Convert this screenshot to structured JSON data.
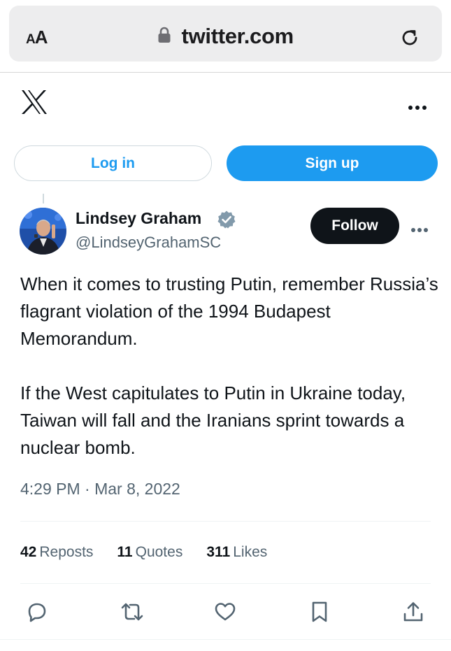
{
  "browser": {
    "text_size_label_large": "A",
    "text_size_label_small": "A",
    "url": "twitter.com"
  },
  "auth": {
    "login_label": "Log in",
    "signup_label": "Sign up"
  },
  "tweet": {
    "author_name": "Lindsey Graham",
    "author_handle": "@LindseyGrahamSC",
    "follow_label": "Follow",
    "text": "When it comes to trusting Putin, remember Russia’s flagrant violation of the 1994 Budapest Memorandum.\n\nIf the West capitulates to Putin in Ukraine today, Taiwan will fall and the Iranians sprint towards a nuclear bomb.",
    "time": "4:29 PM",
    "separator": "·",
    "date": "Mar 8, 2022",
    "stats": {
      "reposts_count": "42",
      "reposts_label": "Reposts",
      "quotes_count": "11",
      "quotes_label": "Quotes",
      "likes_count": "311",
      "likes_label": "Likes"
    }
  },
  "icons": [
    "lock-icon",
    "reload-icon",
    "x-logo-icon",
    "more-icon",
    "verified-badge-icon",
    "reply-icon",
    "repost-icon",
    "like-icon",
    "bookmark-icon",
    "share-icon"
  ],
  "colors": {
    "brand_blue": "#1d9bf0",
    "text_primary": "#0f1419",
    "text_secondary": "#536471",
    "verified_badge": "#829aab"
  }
}
